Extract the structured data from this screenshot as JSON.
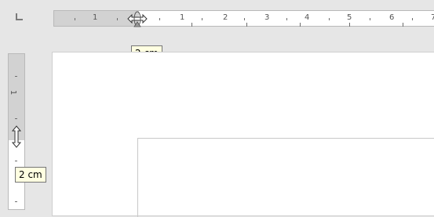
{
  "horizontal_ruler": {
    "numbers": [
      "1",
      "1",
      "2",
      "3",
      "4",
      "5",
      "6",
      "7"
    ],
    "tooltip": "2 cm"
  },
  "vertical_ruler": {
    "numbers": [
      "1"
    ],
    "tooltip": "2 cm"
  },
  "icons": {
    "tab_stop": "left-tab-stop-icon",
    "h_resize": "resize-horizontal-icon",
    "v_resize": "resize-vertical-icon"
  },
  "colors": {
    "tooltip_bg": "#ffffe1",
    "ruler_bg": "#d9d9d9",
    "workspace_bg": "#e6e6e6"
  }
}
